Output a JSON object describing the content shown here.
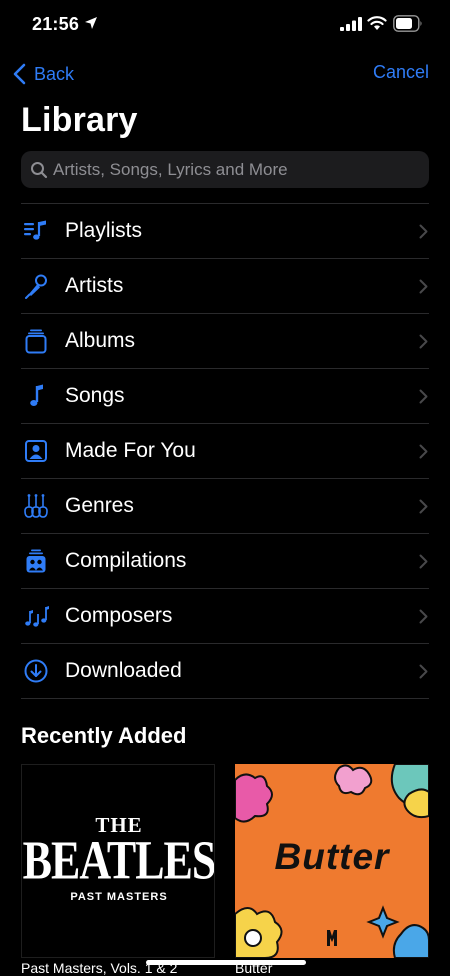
{
  "status_bar": {
    "time": "21:56"
  },
  "nav": {
    "back_label": "Back",
    "cancel_label": "Cancel"
  },
  "title": "Library",
  "search": {
    "placeholder": "Artists, Songs, Lyrics and More",
    "value": ""
  },
  "menu": [
    {
      "label": "Playlists",
      "icon": "playlists-icon"
    },
    {
      "label": "Artists",
      "icon": "microphone-icon"
    },
    {
      "label": "Albums",
      "icon": "album-stack-icon"
    },
    {
      "label": "Songs",
      "icon": "music-note-icon"
    },
    {
      "label": "Made For You",
      "icon": "person-square-icon"
    },
    {
      "label": "Genres",
      "icon": "guitars-icon"
    },
    {
      "label": "Compilations",
      "icon": "compilation-icon"
    },
    {
      "label": "Composers",
      "icon": "music-notes-icon"
    },
    {
      "label": "Downloaded",
      "icon": "download-circle-icon"
    }
  ],
  "recently_added": {
    "title": "Recently Added",
    "albums": [
      {
        "caption": "Past Masters, Vols. 1 & 2",
        "art_the": "THE",
        "art_name": "BEATLES",
        "art_sub": "PAST MASTERS"
      },
      {
        "caption": "Butter",
        "art_name": "Butter"
      }
    ]
  },
  "colors": {
    "accent": "#2f7cf6",
    "background": "#000000",
    "separator": "#2a2a2c",
    "search_bg": "#1c1c1e"
  }
}
